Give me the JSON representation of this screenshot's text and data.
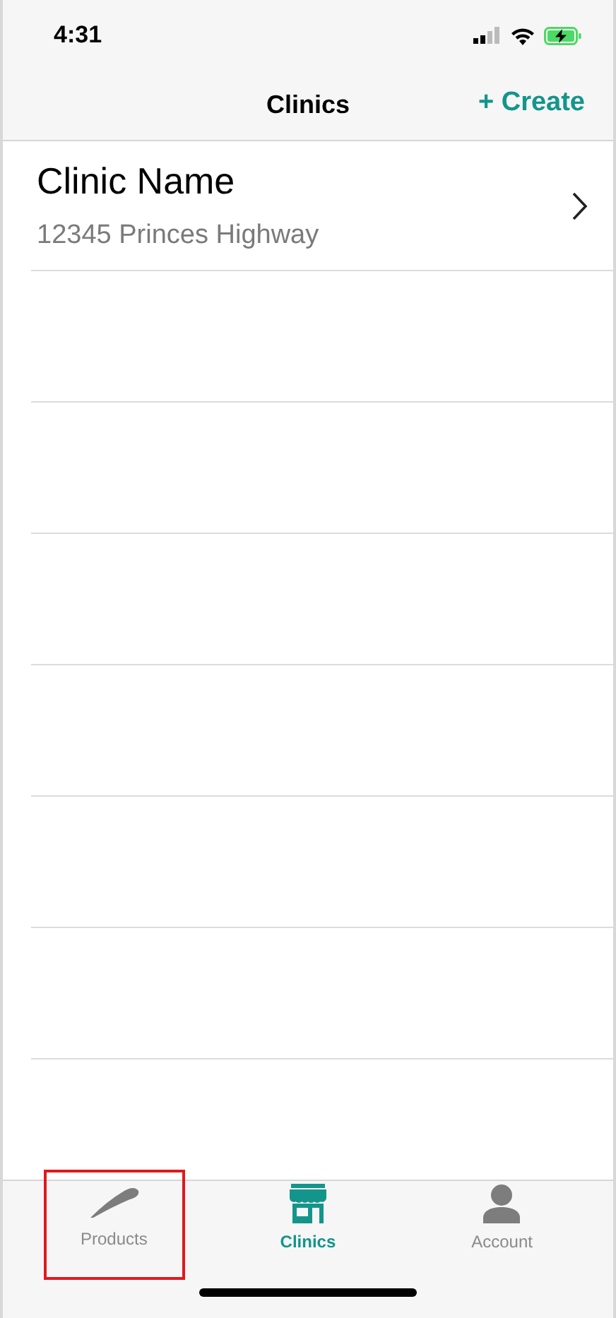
{
  "status_bar": {
    "time": "4:31"
  },
  "nav": {
    "title": "Clinics",
    "action": "+ Create"
  },
  "clinics": [
    {
      "name": "Clinic Name",
      "address": "12345 Princes Highway"
    }
  ],
  "tabs": [
    {
      "kind": "products",
      "label": "Products",
      "selected": false,
      "highlighted": true
    },
    {
      "kind": "clinics",
      "label": "Clinics",
      "selected": true,
      "highlighted": false
    },
    {
      "kind": "account",
      "label": "Account",
      "selected": false,
      "highlighted": false
    }
  ]
}
